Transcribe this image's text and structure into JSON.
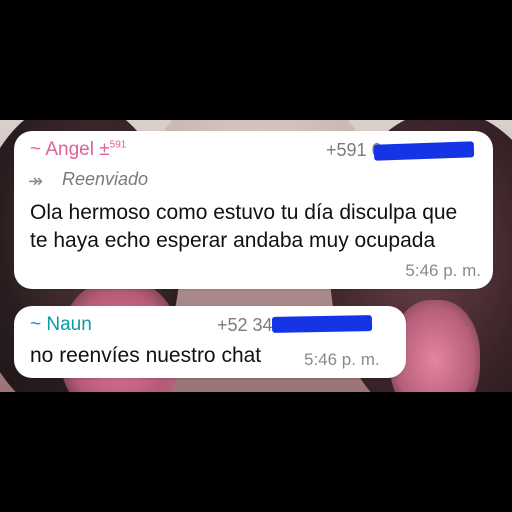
{
  "messages": [
    {
      "sender": "~ Angel ±",
      "sender_sup": "591",
      "phone": "+591 6",
      "forwarded_label": "Reenviado",
      "forward_icon": "↠",
      "text": "Ola hermoso como estuvo tu día disculpa que te haya echo esperar andaba muy ocupada",
      "time": "5:46 p. m."
    },
    {
      "sender": "~ Naun",
      "phone": "+52 342 1                 4",
      "text": "no reenvíes nuestro chat",
      "time": "5:46 p. m."
    }
  ],
  "colors": {
    "sender1": "#e0609a",
    "sender2": "#0a9aa8",
    "redaction": "#1434e6"
  }
}
